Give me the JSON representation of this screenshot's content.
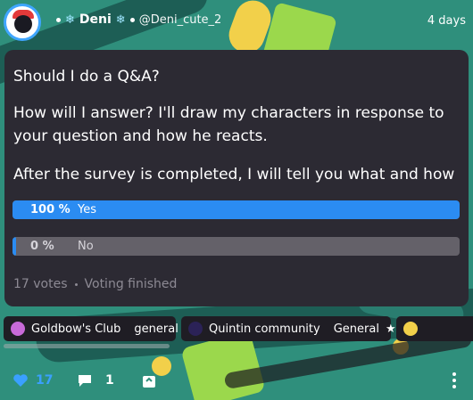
{
  "post": {
    "display_name": "Deni",
    "handle": "@Deni_cute_2",
    "time_ago": "4 days",
    "title": "Should I do a Q&A?",
    "paragraph1": "How will I answer? I'll draw my characters in response to your question and how he reacts.",
    "paragraph2": "After the survey is completed, I will tell you what and how"
  },
  "poll": {
    "options": [
      {
        "percent_text": "100 %",
        "label": "Yes",
        "fraction": 1.0
      },
      {
        "percent_text": "0 %",
        "label": "No",
        "fraction": 0.0
      }
    ],
    "votes": "17 votes",
    "status": "Voting finished"
  },
  "communities": [
    {
      "name": "Goldbow's Club",
      "channel": "general",
      "icon_color": "#c86ad9"
    },
    {
      "name": "Quintin community",
      "channel": "General",
      "icon_color": "#2b2257"
    },
    {
      "name": "",
      "channel": "",
      "icon_color": "#f2d04a"
    }
  ],
  "actions": {
    "likes": "17",
    "comments": "1"
  },
  "icons": {
    "heart": "heart-icon",
    "comment": "comment-icon",
    "share": "share-icon",
    "more": "more-icon",
    "snowflake": "snowflake-icon"
  },
  "colors": {
    "accent": "#2b8cf2",
    "card_bg": "#2c2a33",
    "background": "#2f8f7c"
  }
}
